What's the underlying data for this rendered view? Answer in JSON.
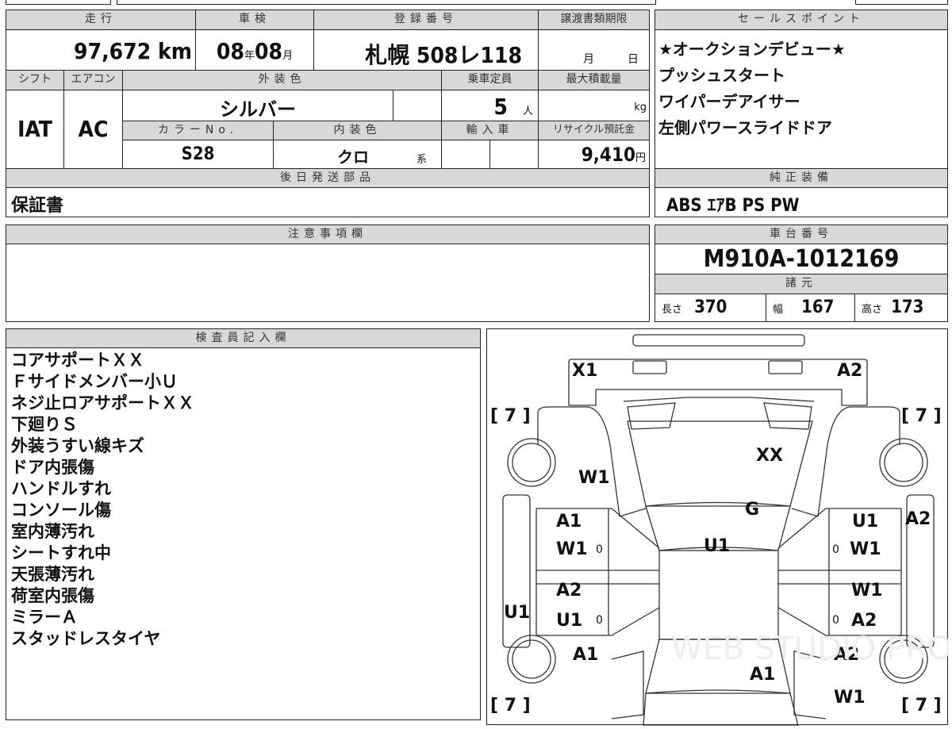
{
  "summary": {
    "mileage_label": "走行",
    "mileage": "97,672",
    "mileage_unit": "km",
    "inspection_label": "車検",
    "inspection_year": "08",
    "year_unit": "年",
    "inspection_month": "08",
    "month_unit": "月",
    "reg_label": "登録番号",
    "reg_number": "札幌 508レ118",
    "transfer_label": "譲渡書類期限",
    "transfer_month_unit": "月",
    "transfer_day_unit": "日",
    "shift_label": "シフト",
    "shift": "IAT",
    "ac_label": "エアコン",
    "ac": "AC",
    "ext_color_label": "外装色",
    "ext_color": "シルバー",
    "capacity_label": "乗車定員",
    "capacity": "5",
    "capacity_unit": "人",
    "max_load_label": "最大積載量",
    "max_load_unit": "kg",
    "color_no_label": "カラーNo.",
    "color_no": "S28",
    "int_color_label": "内装色",
    "int_color": "クロ",
    "int_color_suffix": "系",
    "import_label": "輸入車",
    "recycle_label": "リサイクル預託金",
    "recycle": "9,410",
    "recycle_unit": "円",
    "later_parts_label": "後日発送部品",
    "later_parts": "保証書"
  },
  "sales_points": {
    "label": "セールスポイント",
    "items": [
      "★オークションデビュー★",
      "プッシュスタート",
      "ワイパーデアイサー",
      "左側パワースライドドア"
    ]
  },
  "equipment": {
    "label": "純正装備",
    "value": "ABS ｴｱB PS PW"
  },
  "caution": {
    "label": "注意事項欄"
  },
  "chassis": {
    "label": "車台番号",
    "value": "M910A-1012169"
  },
  "specs": {
    "label": "諸元",
    "length_label": "長さ",
    "length": "370",
    "width_label": "幅",
    "width": "167",
    "height_label": "高さ",
    "height": "173"
  },
  "inspector": {
    "label": "検査員記入欄",
    "notes": [
      "コアサポートＸＸ",
      "Ｆサイドメンバー小Ｕ",
      "ネジ止ロアサポートＸＸ",
      "下廻りＳ",
      "外装うすい線キズ",
      "ドア内張傷",
      "ハンドルすれ",
      "コンソール傷",
      "室内薄汚れ",
      "シートすれ中",
      "天張薄汚れ",
      "荷室内張傷",
      "ミラーＡ",
      "スタッドレスタイヤ"
    ]
  },
  "diagram": {
    "tire_marks": [
      "[ 7 ]",
      "[ 7 ]",
      "[ 7 ]",
      "[ 7 ]"
    ],
    "labels": [
      "X1",
      "A2",
      "XX",
      "W1",
      "G",
      "A1",
      "W1",
      "U1",
      "U1",
      "W1",
      "A2",
      "A2",
      "U1",
      "U1",
      "W1",
      "A2",
      "A1",
      "A2",
      "A1",
      "W1"
    ],
    "zero_marks": [
      "0",
      "0",
      "0",
      "0"
    ],
    "watermark": "WEB STUDIO PRO"
  }
}
